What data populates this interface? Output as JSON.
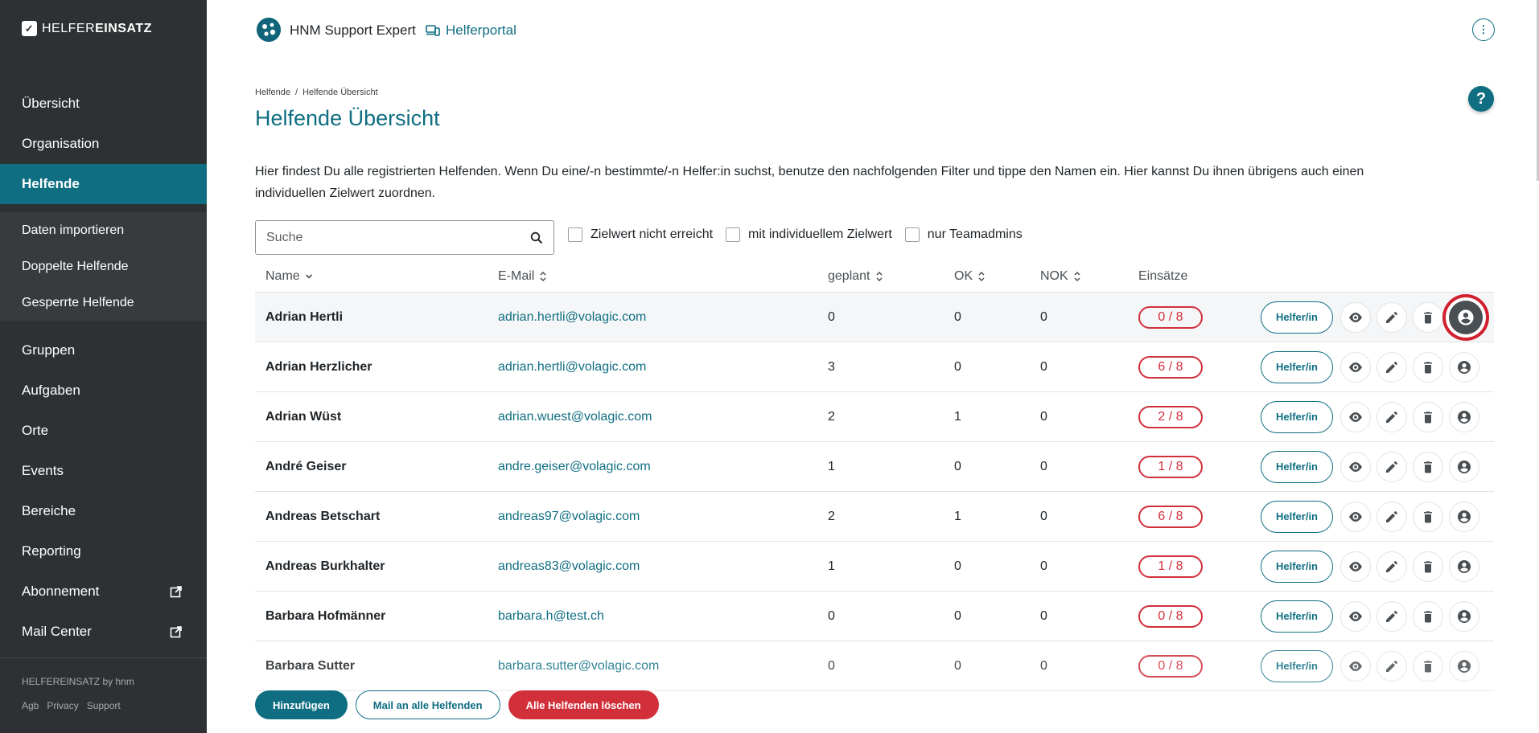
{
  "brand": {
    "logo_text_a": "HELFER",
    "logo_text_b": "EINSATZ"
  },
  "sidebar": {
    "items_top": [
      {
        "label": "Übersicht"
      },
      {
        "label": "Organisation"
      },
      {
        "label": "Helfende",
        "active": true
      }
    ],
    "sub_items": [
      {
        "label": "Daten importieren"
      },
      {
        "label": "Doppelte Helfende"
      },
      {
        "label": "Gesperrte Helfende"
      }
    ],
    "items_bottom": [
      {
        "label": "Gruppen"
      },
      {
        "label": "Aufgaben"
      },
      {
        "label": "Orte"
      },
      {
        "label": "Events"
      },
      {
        "label": "Bereiche"
      },
      {
        "label": "Reporting"
      },
      {
        "label": "Abonnement",
        "icon": "external-link-icon"
      },
      {
        "label": "Mail Center",
        "icon": "external-link-icon"
      }
    ],
    "footer_brand": "HELFEREINSATZ by hnm",
    "footer_links": [
      "Agb",
      "Privacy",
      "Support"
    ]
  },
  "header": {
    "org_name": "HNM Support Expert",
    "portal_label": "Helferportal",
    "menu_icon": "more-vertical-icon"
  },
  "breadcrumb": [
    "Helfende",
    "/",
    "Helfende Übersicht"
  ],
  "help_label": "?",
  "page_title": "Helfende Übersicht",
  "intro_text": "Hier findest Du alle registrierten Helfenden. Wenn Du eine/-n bestimmte/-n Helfer:in suchst, benutze den nachfolgenden Filter und tippe den Namen ein. Hier kannst Du ihnen übrigens auch einen individuellen Zielwert zuordnen.",
  "search": {
    "placeholder": "Suche"
  },
  "filters": [
    "Zielwert nicht erreicht",
    "mit individuellem Zielwert",
    "nur Teamadmins"
  ],
  "table": {
    "columns": [
      "Name",
      "E-Mail",
      "geplant",
      "OK",
      "NOK",
      "Einsätze"
    ],
    "role_label": "Helfer/in",
    "rows": [
      {
        "name": "Adrian Hertli",
        "email": "adrian.hertli@volagic.com",
        "planned": "0",
        "ok": "0",
        "nok": "0",
        "einsaetze": "0 / 8"
      },
      {
        "name": "Adrian Herzlicher",
        "email": "adrian.hertli@volagic.com",
        "planned": "3",
        "ok": "0",
        "nok": "0",
        "einsaetze": "6 / 8"
      },
      {
        "name": "Adrian Wüst",
        "email": "adrian.wuest@volagic.com",
        "planned": "2",
        "ok": "1",
        "nok": "0",
        "einsaetze": "2 / 8"
      },
      {
        "name": "André Geiser",
        "email": "andre.geiser@volagic.com",
        "planned": "1",
        "ok": "0",
        "nok": "0",
        "einsaetze": "1 / 8"
      },
      {
        "name": "Andreas Betschart",
        "email": "andreas97@volagic.com",
        "planned": "2",
        "ok": "1",
        "nok": "0",
        "einsaetze": "6 / 8"
      },
      {
        "name": "Andreas Burkhalter",
        "email": "andreas83@volagic.com",
        "planned": "1",
        "ok": "0",
        "nok": "0",
        "einsaetze": "1 / 8"
      },
      {
        "name": "Barbara Hofmänner",
        "email": "barbara.h@test.ch",
        "planned": "0",
        "ok": "0",
        "nok": "0",
        "einsaetze": "0 / 8"
      },
      {
        "name": "Barbara Sutter",
        "email": "barbara.sutter@volagic.com",
        "planned": "0",
        "ok": "0",
        "nok": "0",
        "einsaetze": "0 / 8"
      }
    ]
  },
  "bottom_buttons": {
    "add": "Hinzufügen",
    "mail_all": "Mail an alle Helfenden",
    "delete_all": "Alle Helfenden löschen"
  },
  "colors": {
    "accent": "#0f6e82",
    "sidebar": "#2e3133",
    "danger": "#d1303b",
    "highlight_ring": "#d1202e"
  }
}
